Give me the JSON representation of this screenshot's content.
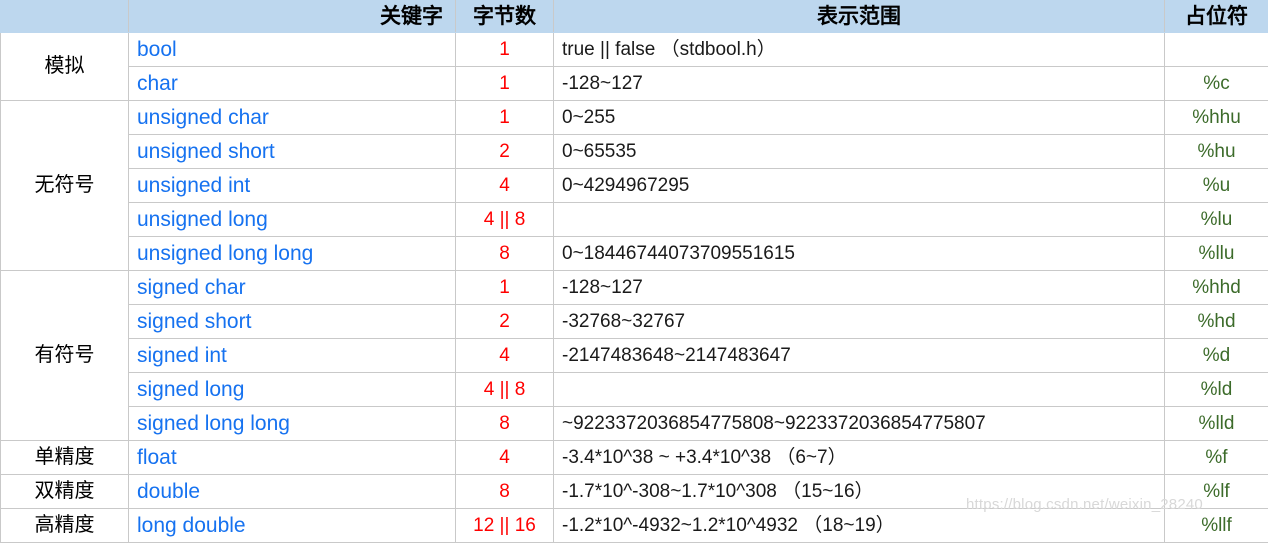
{
  "table": {
    "headers": {
      "group": "",
      "keyword": "关键字",
      "bytes": "字节数",
      "range": "表示范围",
      "format": "占位符"
    },
    "groups": [
      {
        "label": "模拟",
        "rowspan": 2,
        "rows": [
          {
            "keyword": "bool",
            "bytes": "1",
            "range": "true || false （stdbool.h）",
            "format": ""
          },
          {
            "keyword": "char",
            "bytes": "1",
            "range": "-128~127",
            "format": "%c"
          }
        ]
      },
      {
        "label": "无符号",
        "rowspan": 5,
        "rows": [
          {
            "keyword": "unsigned char",
            "bytes": "1",
            "range": "0~255",
            "format": "%hhu"
          },
          {
            "keyword": "unsigned short",
            "bytes": "2",
            "range": "0~65535",
            "format": "%hu"
          },
          {
            "keyword": "unsigned int",
            "bytes": "4",
            "range": "0~4294967295",
            "format": "%u"
          },
          {
            "keyword": "unsigned long",
            "bytes": "4 || 8",
            "range": "",
            "format": "%lu"
          },
          {
            "keyword": "unsigned long long",
            "bytes": "8",
            "range": "0~18446744073709551615",
            "format": "%llu"
          }
        ]
      },
      {
        "label": "有符号",
        "rowspan": 5,
        "rows": [
          {
            "keyword": "signed char",
            "bytes": "1",
            "range": "-128~127",
            "format": "%hhd"
          },
          {
            "keyword": "signed short",
            "bytes": "2",
            "range": "-32768~32767",
            "format": "%hd"
          },
          {
            "keyword": "signed int",
            "bytes": "4",
            "range": "-2147483648~2147483647",
            "format": "%d"
          },
          {
            "keyword": "signed long",
            "bytes": "4 || 8",
            "range": "",
            "format": "%ld"
          },
          {
            "keyword": "signed long long",
            "bytes": "8",
            "range": "~9223372036854775808~9223372036854775807",
            "format": "%lld"
          }
        ]
      },
      {
        "label": "单精度",
        "rowspan": 1,
        "rows": [
          {
            "keyword": "float",
            "bytes": "4",
            "range": "-3.4*10^38 ~ +3.4*10^38 （6~7）",
            "format": "%f"
          }
        ]
      },
      {
        "label": "双精度",
        "rowspan": 1,
        "rows": [
          {
            "keyword": "double",
            "bytes": "8",
            "range": "-1.7*10^-308~1.7*10^308 （15~16）",
            "format": "%lf"
          }
        ]
      },
      {
        "label": "高精度",
        "rowspan": 1,
        "rows": [
          {
            "keyword": "long double",
            "bytes": "12 || 16",
            "range": "-1.2*10^-4932~1.2*10^4932 （18~19）",
            "format": "%llf"
          }
        ]
      }
    ]
  },
  "watermark": {
    "text": "https://blog.csdn.net/weixin_28240"
  },
  "colors": {
    "header_bg": "#bdd7ee",
    "keyword": "#1672f0",
    "bytes": "#ff0000",
    "format": "#3c6b2a",
    "grid": "#c9c9c9"
  }
}
